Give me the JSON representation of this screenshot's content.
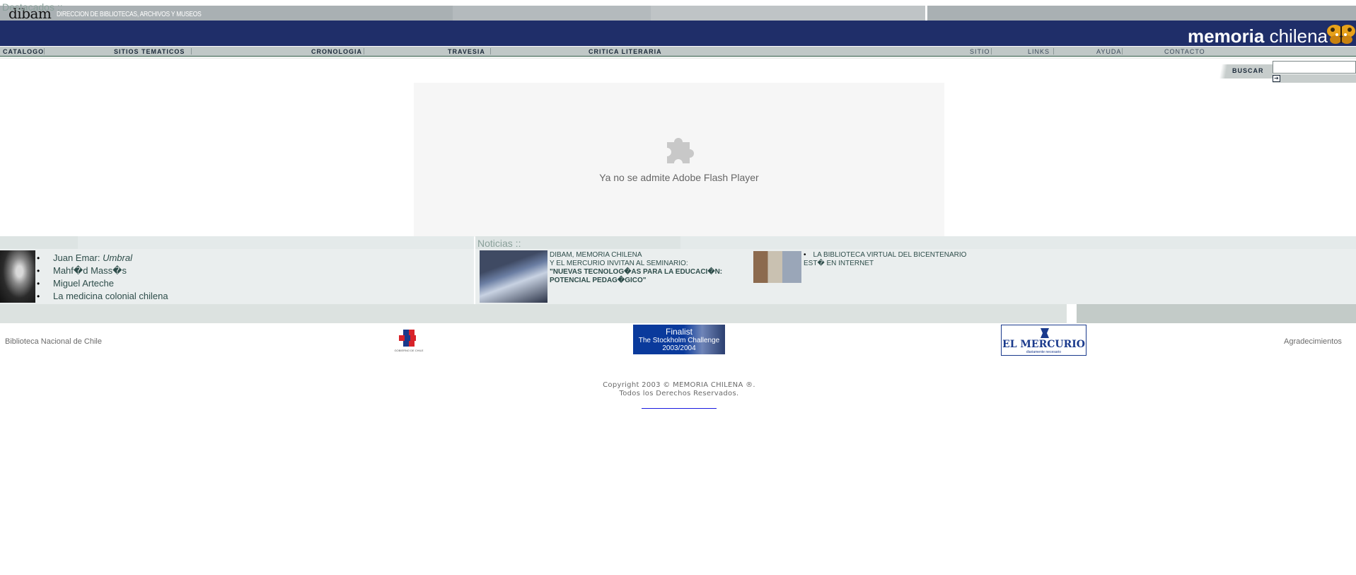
{
  "header": {
    "dibam_logo": "dibam",
    "dibam_subtitle": "DIRECCION DE BIBLIOTECAS, ARCHIVOS Y MUSEOS",
    "brand_bold": "memoria",
    "brand_light": " chilena",
    "brand_icon": "butterfly-icon"
  },
  "nav": {
    "main": [
      "CATALOGO",
      "SITIOS TEMATICOS",
      "CRONOLOGIA",
      "TRAVESIA",
      "CRITICA LITERARIA"
    ],
    "secondary": [
      "SITIO",
      "LINKS",
      "AYUDA",
      "CONTACTO"
    ]
  },
  "search": {
    "label": "BUSCAR",
    "value": "",
    "go_symbol": "➔"
  },
  "flash": {
    "icon": "puzzle-icon",
    "message": "Ya no se admite Adobe Flash Player"
  },
  "destacados": {
    "title": "Destacados ::",
    "items": [
      {
        "prefix": "Juan Emar: ",
        "italic": "Umbral"
      },
      {
        "prefix": "Mahf�d Mass�s",
        "italic": ""
      },
      {
        "prefix": "Miguel Arteche",
        "italic": ""
      },
      {
        "prefix": "La medicina colonial chilena",
        "italic": ""
      }
    ]
  },
  "noticias": {
    "title": "Noticias ::",
    "item1": {
      "line1": "DIBAM, MEMORIA CHILENA",
      "line2": "Y EL MERCURIO INVITAN AL SEMINARIO:",
      "bold": "\"NUEVAS TECNOLOG�AS PARA LA EDUCACI�N: POTENCIAL PEDAG�GICO\""
    },
    "item2": {
      "bullet": "•",
      "text": "LA BIBLIOTECA VIRTUAL DEL BICENTENARIO EST� EN INTERNET"
    }
  },
  "footer": {
    "left_link": "Biblioteca Nacional de Chile",
    "gob_text": "GOBIERNO DE CHILE",
    "stockholm_title": "Finalist",
    "stockholm_sub1": "The Stockholm Challenge",
    "stockholm_sub2": "2003/2004",
    "mercurio_name": "EL MERCURIO",
    "mercurio_tag": "diariamente necesario",
    "right_link": "Agradecimientos",
    "copyright1": "Copyright 2003 © MEMORIA CHILENA ®.",
    "copyright2": "Todos los Derechos Reservados."
  },
  "colors": {
    "navy": "#1f2e69",
    "nav_bg": "#c0c8c7",
    "section_bg": "#eaeeee",
    "text_teal": "#2e4d4a"
  }
}
